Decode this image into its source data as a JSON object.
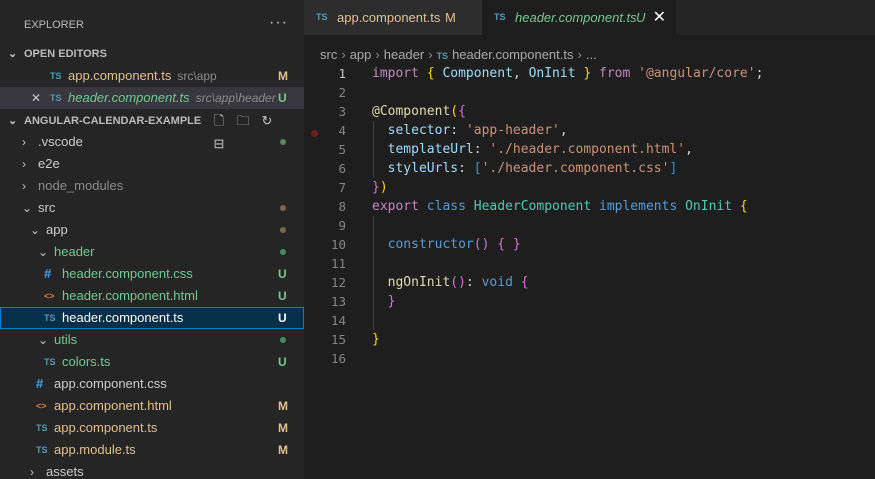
{
  "explorer": {
    "title": "EXPLORER",
    "more": "···",
    "open_editors": {
      "title": "OPEN EDITORS",
      "items": [
        {
          "icon": "TS",
          "name": "app.component.ts",
          "desc": "src\\app",
          "badge": "M"
        },
        {
          "icon": "TS",
          "name": "header.component.ts",
          "desc": "src\\app\\header",
          "badge": "U",
          "close": "✕"
        }
      ]
    },
    "project": {
      "title": "ANGULAR-CALENDAR-EXAMPLE",
      "tree": [
        {
          "name": ".vscode"
        },
        {
          "name": "e2e"
        },
        {
          "name": "node_modules"
        },
        {
          "name": "src"
        },
        {
          "name": "app"
        },
        {
          "name": "header"
        },
        {
          "icon": "#",
          "name": "header.component.css",
          "badge": "U"
        },
        {
          "icon": "<>",
          "name": "header.component.html",
          "badge": "U"
        },
        {
          "icon": "TS",
          "name": "header.component.ts",
          "badge": "U"
        },
        {
          "name": "utils"
        },
        {
          "icon": "TS",
          "name": "colors.ts",
          "badge": "U"
        },
        {
          "icon": "#",
          "name": "app.component.css"
        },
        {
          "icon": "<>",
          "name": "app.component.html",
          "badge": "M"
        },
        {
          "icon": "TS",
          "name": "app.component.ts",
          "badge": "M"
        },
        {
          "icon": "TS",
          "name": "app.module.ts",
          "badge": "M"
        },
        {
          "name": "assets"
        }
      ]
    }
  },
  "tabs": [
    {
      "icon": "TS",
      "label": "app.component.ts",
      "badge": "M"
    },
    {
      "icon": "TS",
      "label": "header.component.ts",
      "badge": "U",
      "close": "✕"
    }
  ],
  "breadcrumb": {
    "parts": [
      "src",
      "app",
      "header"
    ],
    "file_icon": "TS",
    "file": "header.component.ts",
    "more": "..."
  },
  "editor": {
    "line_numbers": [
      "1",
      "2",
      "3",
      "4",
      "5",
      "6",
      "7",
      "8",
      "9",
      "10",
      "11",
      "12",
      "13",
      "14",
      "15",
      "16"
    ],
    "code": {
      "l1_import": "import",
      "l1_obrace": "{",
      "l1_component": "Component",
      "l1_comma": ",",
      "l1_oninit": "OnInit",
      "l1_cbrace": "}",
      "l1_from": "from",
      "l1_module": "'@angular/core'",
      "l1_semi": ";",
      "l3_at": "@",
      "l3_decorator": "Component",
      "l3_oparen": "(",
      "l3_obrace": "{",
      "l4_key": "selector",
      "l4_colon": ": ",
      "l4_value": "'app-header'",
      "l4_comma": ",",
      "l5_key": "templateUrl",
      "l5_colon": ": ",
      "l5_value": "'./header.component.html'",
      "l5_comma": ",",
      "l6_key": "styleUrls",
      "l6_colon": ": ",
      "l6_obr": "[",
      "l6_value": "'./header.component.css'",
      "l6_cbr": "]",
      "l7_cbrace": "}",
      "l7_cparen": ")",
      "l8_export": "export",
      "l8_class": "class",
      "l8_name": "HeaderComponent",
      "l8_implements": "implements",
      "l8_iface": "OnInit",
      "l8_obrace": "{",
      "l10_ctor": "constructor",
      "l10_parens": "()",
      "l10_braces": "{ }",
      "l12_method": "ngOnInit",
      "l12_parens": "()",
      "l12_colon": ": ",
      "l12_type": "void",
      "l12_obrace": "{",
      "l13_cbrace": "}",
      "l15_cbrace": "}"
    }
  },
  "colors": {
    "modified": "#e2c08d",
    "untracked": "#73c991",
    "ts_icon": "#519aba",
    "selection": "#062f4a",
    "focus_border": "#007fd4"
  }
}
